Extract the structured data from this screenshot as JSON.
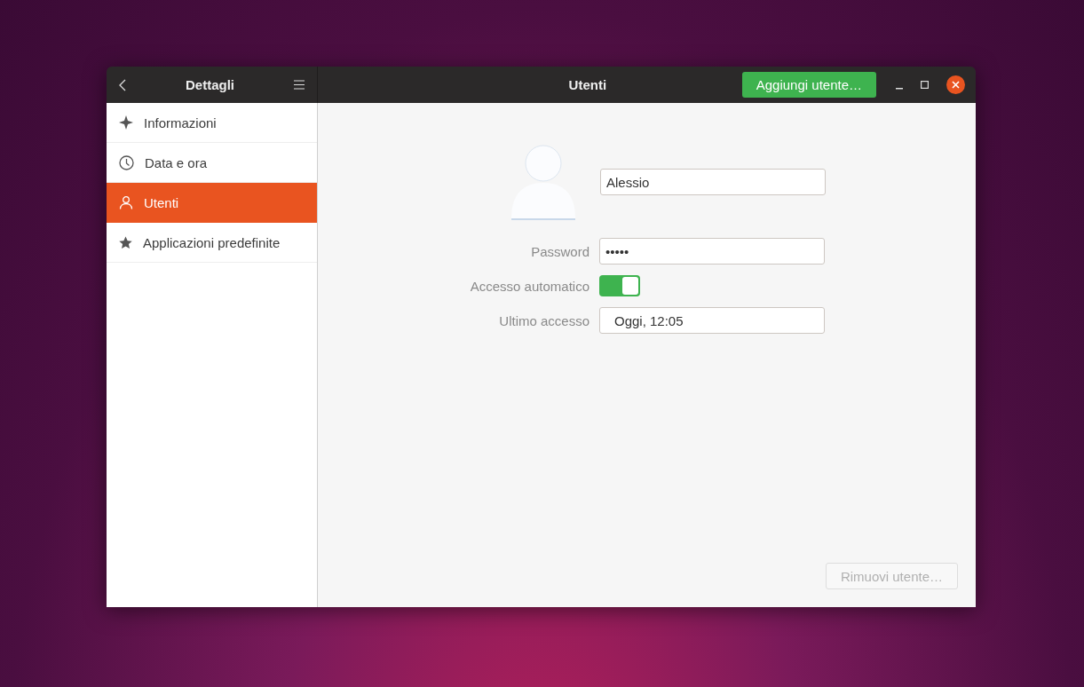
{
  "window": {
    "title": "Utenti",
    "sidebar_title": "Dettagli"
  },
  "header_button": {
    "label": "Aggiungi utente…"
  },
  "sidebar": {
    "items": [
      {
        "label": "Informazioni",
        "kind": "sparkle",
        "selected": false
      },
      {
        "label": "Data e ora",
        "kind": "clock",
        "selected": false
      },
      {
        "label": "Utenti",
        "kind": "person",
        "selected": true
      },
      {
        "label": "Applicazioni predefinite",
        "kind": "star",
        "selected": false
      }
    ]
  },
  "user": {
    "name": "Alessio",
    "rows": [
      {
        "kind": "field",
        "label": "Password",
        "value": "•••••"
      },
      {
        "kind": "switch",
        "label": "Accesso automatico",
        "on": true
      },
      {
        "kind": "button",
        "label": "Ultimo accesso",
        "value": "Oggi, 12:05"
      }
    ]
  },
  "remove_button": {
    "label": "Rimuovi utente…",
    "disabled": true
  }
}
